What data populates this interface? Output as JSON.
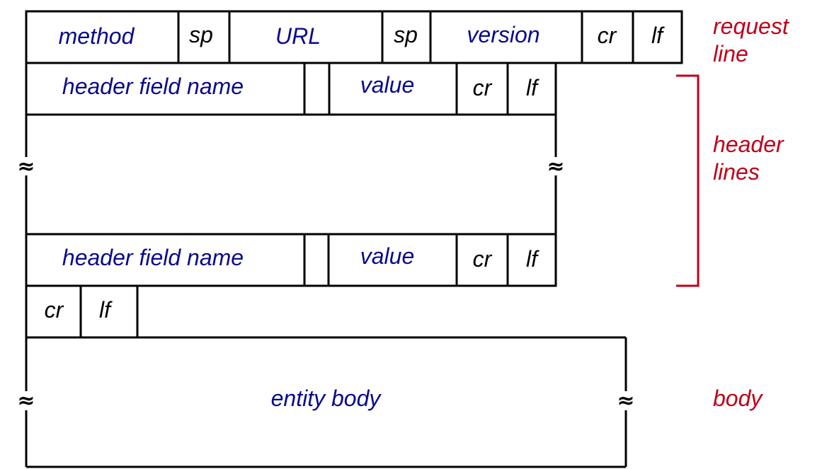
{
  "request_line": {
    "fields": [
      "method",
      "sp",
      "URL",
      "sp",
      "version",
      "cr",
      "lf"
    ]
  },
  "header_line_1": {
    "fields": [
      "header field name",
      "",
      "value",
      "cr",
      "lf"
    ]
  },
  "header_line_2": {
    "fields": [
      "header field name",
      "",
      "value",
      "cr",
      "lf"
    ]
  },
  "blank_line": {
    "fields": [
      "cr",
      "lf"
    ]
  },
  "body": {
    "label": "entity body"
  },
  "break_symbol": "≈",
  "side_labels": {
    "request_line": [
      "request",
      "line"
    ],
    "header_lines": [
      "header",
      "lines"
    ],
    "body": "body"
  },
  "colors": {
    "field_text": "#0a0a8c",
    "delimiter_text": "#000000",
    "side_label": "#c0001a",
    "bracket": "#c0001a"
  }
}
